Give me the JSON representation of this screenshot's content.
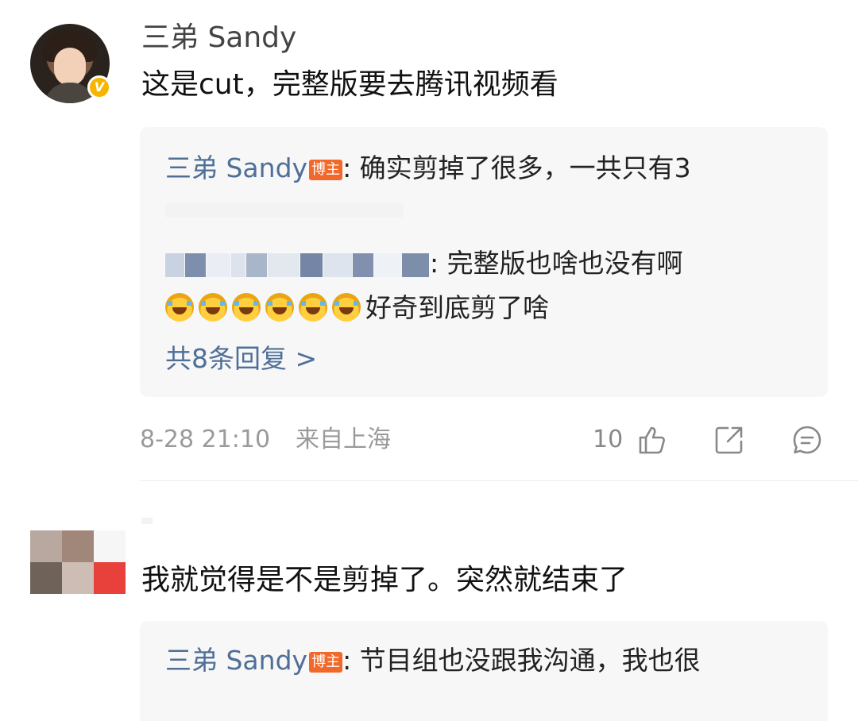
{
  "comment1": {
    "username": "三弟 Sandy",
    "verified_badge": "V",
    "text": "这是cut，完整版要去腾讯视频看",
    "replies": [
      {
        "user": "三弟 Sandy",
        "badge": "博主",
        "text": ": 确实剪掉了很多，一共只有3"
      },
      {
        "user_blurred": true,
        "text": ": 完整版也啥也没有啊",
        "emoji_icon": "laugh-cry-emoji",
        "emoji_count": 6,
        "text_after_emoji": "好奇到底剪了啥"
      }
    ],
    "more_replies_label": "共8条回复 >",
    "timestamp": "8-28 21:10",
    "location": "来自上海",
    "like_count": "10",
    "icons": [
      "thumbs-up-icon",
      "share-icon",
      "comment-icon"
    ]
  },
  "comment2": {
    "avatar_blurred": true,
    "text": "我就觉得是不是剪掉了。突然就结束了",
    "replies": [
      {
        "user": "三弟 Sandy",
        "badge": "博主",
        "text": ": 节目组也没跟我沟通，我也很"
      }
    ]
  },
  "colors": {
    "link_blue": "#4f6f97",
    "badge_orange": "#f2682b",
    "verified_gold": "#f7b500",
    "meta_gray": "#9a9a9a",
    "reply_bg": "#f7f7f7"
  }
}
